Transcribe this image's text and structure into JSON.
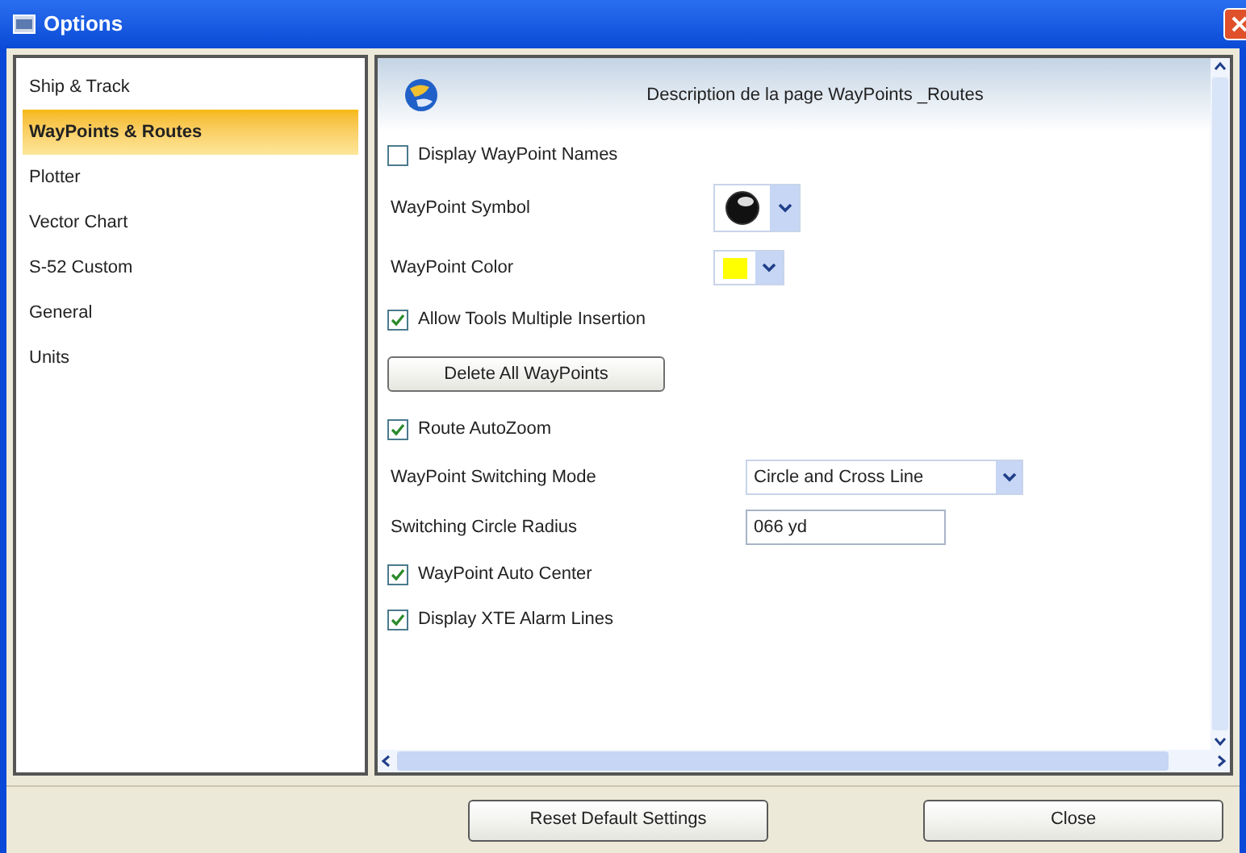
{
  "window": {
    "title": "Options"
  },
  "sidebar": {
    "items": [
      {
        "label": "Ship & Track",
        "selected": false
      },
      {
        "label": "WayPoints & Routes",
        "selected": true
      },
      {
        "label": "Plotter",
        "selected": false
      },
      {
        "label": "Vector Chart",
        "selected": false
      },
      {
        "label": "S-52 Custom",
        "selected": false
      },
      {
        "label": "General",
        "selected": false
      },
      {
        "label": "Units",
        "selected": false
      }
    ]
  },
  "page": {
    "description": "Description de la page WayPoints _Routes",
    "settings": [
      {
        "kind": "checkbox",
        "label": "Display WayPoint Names",
        "checked": false
      },
      {
        "kind": "symbol",
        "label": "WayPoint Symbol"
      },
      {
        "kind": "color",
        "label": "WayPoint Color",
        "color": "#ffff00"
      },
      {
        "kind": "checkbox",
        "label": "Allow Tools Multiple Insertion",
        "checked": true
      },
      {
        "kind": "button",
        "label": "Delete All WayPoints"
      },
      {
        "kind": "checkbox",
        "label": "Route AutoZoom",
        "checked": true
      },
      {
        "kind": "select",
        "label": "WayPoint Switching Mode",
        "value": "Circle and Cross Line"
      },
      {
        "kind": "text",
        "label": "Switching Circle Radius",
        "value": "066 yd"
      },
      {
        "kind": "checkbox",
        "label": "WayPoint Auto Center",
        "checked": true
      },
      {
        "kind": "checkbox",
        "label": "Display XTE Alarm Lines",
        "checked": true
      }
    ]
  },
  "buttons": [
    "Reset Default Settings",
    "Close"
  ]
}
